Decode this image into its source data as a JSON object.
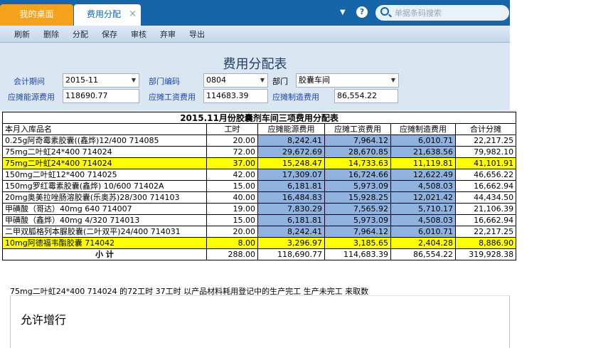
{
  "tabs": {
    "home": "我的桌面",
    "active": "费用分配",
    "close": "×"
  },
  "search": {
    "placeholder": "单据条码搜索"
  },
  "toolbar": {
    "items": [
      "刷新",
      "删除",
      "分配",
      "保存",
      "审核",
      "弃审",
      "导出"
    ]
  },
  "form": {
    "title": "费用分配表",
    "period_label": "会计期间",
    "period_value": "2015-11",
    "dept_code_label": "部门编码",
    "dept_code_value": "0804",
    "dept_label": "部门",
    "dept_value": "胶囊车间",
    "energy_label": "应摊能源费用",
    "energy_value": "118690.77",
    "wage_label": "应摊工资费用",
    "wage_value": "114683.39",
    "mfg_label": "应摊制造费用",
    "mfg_value": "86,554.22"
  },
  "sheet": {
    "title": "2015.11月份胶囊剂车间三项费用分配表",
    "headers": [
      "本月入库品名",
      "工时",
      "应摊能源费用",
      "应摊工资费用",
      "应摊制造费用",
      "合计分摊"
    ],
    "rows": [
      {
        "name": "0.25g阿奇霉素胶囊((鑫烨)12/400 714085",
        "hours": "20.00",
        "energy": "8,242.41",
        "wage": "7,964.12",
        "mfg": "6,010.71",
        "total": "22,217.25",
        "highlight": false
      },
      {
        "name": "75mg二叶虹24*400 714024",
        "hours": "72.00",
        "energy": "29,672.69",
        "wage": "28,670.85",
        "mfg": "21,638.56",
        "total": "79,982.10",
        "highlight": false
      },
      {
        "name": "75mg二叶虹24*400 714024",
        "hours": "37.00",
        "energy": "15,248.47",
        "wage": "14,733.63",
        "mfg": "11,119.81",
        "total": "41,101.91",
        "highlight": true
      },
      {
        "name": "150mg二叶虹12*400 714025",
        "hours": "42.00",
        "energy": "17,309.07",
        "wage": "16,724.66",
        "mfg": "12,622.49",
        "total": "46,656.22",
        "highlight": false
      },
      {
        "name": "150mg罗红霉素胶囊(鑫烨) 10/600 71402A",
        "hours": "15.00",
        "energy": "6,181.81",
        "wage": "5,973.09",
        "mfg": "4,508.03",
        "total": "16,662.94",
        "highlight": false
      },
      {
        "name": "20mg奥美拉唑肠溶胶囊(乐奥苏)28/300 714103",
        "hours": "40.00",
        "energy": "16,484.83",
        "wage": "15,928.25",
        "mfg": "12,021.42",
        "total": "44,434.50",
        "highlight": false
      },
      {
        "name": "甲磺酸（哥达）40mg 640 714007",
        "hours": "19.00",
        "energy": "7,830.29",
        "wage": "7,565.92",
        "mfg": "5,710.17",
        "total": "21,106.39",
        "highlight": false
      },
      {
        "name": "甲磺酸（鑫烨）40mg 4/320 714013",
        "hours": "15.00",
        "energy": "6,181.81",
        "wage": "5,973.09",
        "mfg": "4,508.03",
        "total": "16,662.94",
        "highlight": false
      },
      {
        "name": "二甲双胍格列本脲胶囊(二叶双平)24/400 714031",
        "hours": "20.00",
        "energy": "8,242.41",
        "wage": "7,964.12",
        "mfg": "6,010.71",
        "total": "22,217.25",
        "highlight": false
      },
      {
        "name": "10mg阿德福韦酯胶囊  714042",
        "hours": "8.00",
        "energy": "3,296.97",
        "wage": "3,185.65",
        "mfg": "2,404.28",
        "total": "8,886.90",
        "highlight": true
      }
    ],
    "subtotal": {
      "label": "小            计",
      "hours": "288.00",
      "energy": "118,690.77",
      "wage": "114,683.39",
      "mfg": "86,554.22",
      "total": "319,928.38"
    }
  },
  "note": "75mg二叶虹24*400 714024 的72工时 37工时 以产品材料耗用登记中的生产完工 生产未完工 来取数",
  "lower_text": "允许增行",
  "colors": {
    "tabbar": "#1565a8",
    "home_tab": "#f4a21c",
    "cell_blue": "#8fb2de",
    "highlight_yellow": "#ffff00"
  }
}
